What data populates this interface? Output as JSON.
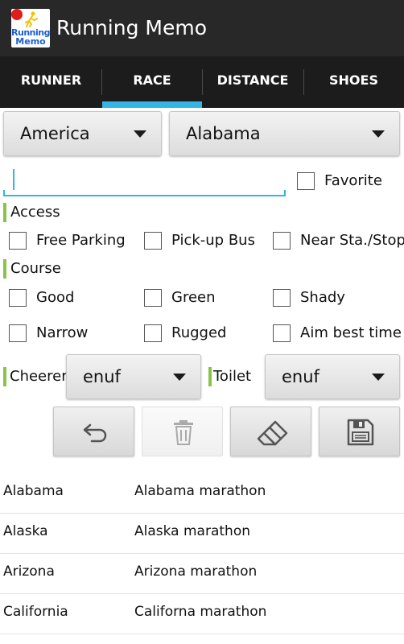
{
  "app": {
    "title": "Running Memo",
    "icon_word_top": "Running",
    "icon_word_bottom": "Memo"
  },
  "tabs": [
    {
      "label": "RUNNER",
      "selected": false
    },
    {
      "label": "RACE",
      "selected": true
    },
    {
      "label": "DISTANCE",
      "selected": false
    },
    {
      "label": "SHOES",
      "selected": false
    }
  ],
  "filters": {
    "country": "America",
    "state": "Alabama"
  },
  "form": {
    "name_value": "",
    "favorite_label": "Favorite",
    "favorite_checked": false
  },
  "access": {
    "label": "Access",
    "options": [
      {
        "label": "Free Parking",
        "checked": false
      },
      {
        "label": "Pick-up Bus",
        "checked": false
      },
      {
        "label": "Near Sta./Stop",
        "checked": false
      }
    ]
  },
  "course": {
    "label": "Course",
    "options": [
      {
        "label": "Good",
        "checked": false
      },
      {
        "label": "Green",
        "checked": false
      },
      {
        "label": "Shady",
        "checked": false
      },
      {
        "label": "Narrow",
        "checked": false
      },
      {
        "label": "Rugged",
        "checked": false
      },
      {
        "label": "Aim best time",
        "checked": false
      }
    ]
  },
  "ratings": {
    "cheerer_label": "Cheerer",
    "cheerer_value": "enuf",
    "toilet_label": "Toilet",
    "toilet_value": "enuf"
  },
  "actions": [
    {
      "icon": "undo-icon",
      "enabled": true
    },
    {
      "icon": "trash-icon",
      "enabled": false
    },
    {
      "icon": "eraser-icon",
      "enabled": true
    },
    {
      "icon": "save-icon",
      "enabled": true
    }
  ],
  "colors": {
    "accent": "#33b5e5",
    "section_marker": "#8bc34a",
    "appbar": "#282828",
    "tabbar": "#1c1c1c"
  },
  "races": [
    {
      "state": "Alabama",
      "name": "Alabama marathon"
    },
    {
      "state": "Alaska",
      "name": "Alaska marathon"
    },
    {
      "state": "Arizona",
      "name": "Arizona marathon"
    },
    {
      "state": "California",
      "name": "Californa marathon"
    }
  ]
}
